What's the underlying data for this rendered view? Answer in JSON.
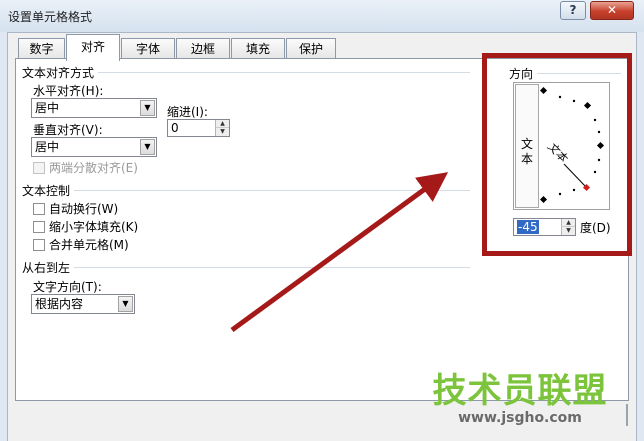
{
  "window": {
    "title": "设置单元格格式",
    "help_label": "?",
    "close_label": "✕"
  },
  "tabs": [
    {
      "label": "数字"
    },
    {
      "label": "对齐",
      "active": true
    },
    {
      "label": "字体"
    },
    {
      "label": "边框"
    },
    {
      "label": "填充"
    },
    {
      "label": "保护"
    }
  ],
  "text_alignment": {
    "section_label": "文本对齐方式",
    "horizontal_label": "水平对齐(H):",
    "horizontal_value": "居中",
    "vertical_label": "垂直对齐(V):",
    "vertical_value": "居中",
    "indent_label": "缩进(I):",
    "indent_value": "0",
    "distributed_label": "两端分散对齐(E)"
  },
  "text_control": {
    "section_label": "文本控制",
    "wrap_label": "自动换行(W)",
    "shrink_label": "缩小字体填充(K)",
    "merge_label": "合并单元格(M)"
  },
  "rtl": {
    "section_label": "从右到左",
    "direction_label": "文字方向(T):",
    "direction_value": "根据内容"
  },
  "orientation": {
    "section_label": "方向",
    "vertical_text": [
      "文",
      "本"
    ],
    "dial_text": "文本",
    "degrees_value": "-45",
    "degrees_unit": "度(D)",
    "angle_degrees": -45
  },
  "watermark": {
    "main": "技术员联盟",
    "sub": "www.jsgho.com"
  },
  "colors": {
    "highlight": "#a61919",
    "watermark_green": "#7cc43c",
    "dial_dot_active": "#d21e1e"
  }
}
